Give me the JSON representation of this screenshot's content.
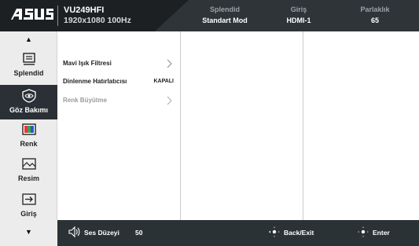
{
  "header": {
    "brand": "/ISUS",
    "model": "VU249HFI",
    "resolution": "1920x1080 100Hz",
    "columns": [
      {
        "label": "Splendid",
        "value": "Standart Mod"
      },
      {
        "label": "Giriş",
        "value": "HDMI-1"
      },
      {
        "label": "Parlaklık",
        "value": "65"
      }
    ]
  },
  "sidebar": {
    "up_arrow": "▲",
    "down_arrow": "▼",
    "items": [
      {
        "label": "Splendid",
        "icon": "splendid-icon",
        "active": false
      },
      {
        "label": "Göz Bakımı",
        "icon": "eye-care-icon",
        "active": true
      },
      {
        "label": "Renk",
        "icon": "color-icon",
        "active": false
      },
      {
        "label": "Resim",
        "icon": "image-icon",
        "active": false
      },
      {
        "label": "Giriş",
        "icon": "input-icon",
        "active": false
      }
    ]
  },
  "menu": {
    "items": [
      {
        "label": "Mavi Işık Filtresi",
        "type": "submenu",
        "enabled": true
      },
      {
        "label": "Dinlenme Hatırlatıcısı",
        "status": "KAPALI",
        "enabled": true
      },
      {
        "label": "Renk Büyütme",
        "type": "submenu",
        "enabled": false
      }
    ]
  },
  "footer": {
    "volume_label": "Ses Düzeyi",
    "volume_value": "50",
    "back_label": "Back/Exit",
    "enter_label": "Enter"
  },
  "colors": {
    "header_bg": "#2e3438",
    "active_item_bg": "#2a3035",
    "sidebar_bg": "#ececec",
    "footer_bg": "#2b3236"
  }
}
